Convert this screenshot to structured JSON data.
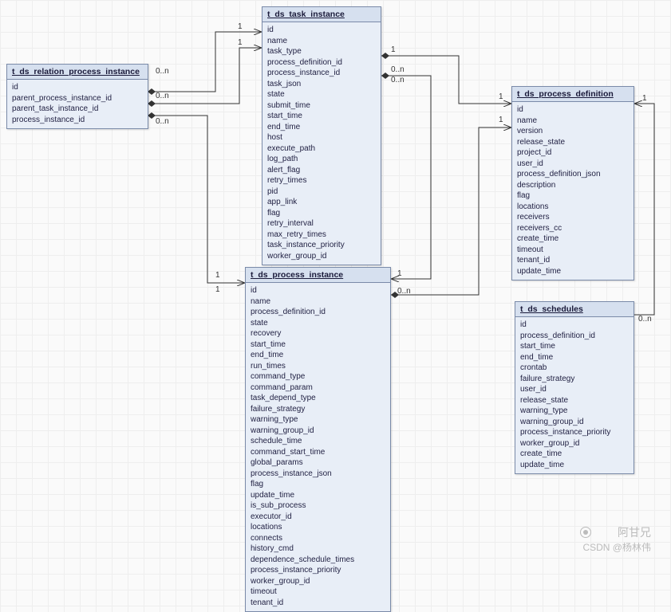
{
  "entities": {
    "relation_process_instance": {
      "title": "t_ds_relation_process_instance",
      "fields": [
        "id",
        "parent_process_instance_id",
        "parent_task_instance_id",
        "process_instance_id"
      ]
    },
    "task_instance": {
      "title": "t_ds_task_instance",
      "fields": [
        "id",
        "name",
        "task_type",
        "process_definition_id",
        "process_instance_id",
        "task_json",
        "state",
        "submit_time",
        "start_time",
        "end_time",
        "host",
        "execute_path",
        "log_path",
        "alert_flag",
        "retry_times",
        "pid",
        "app_link",
        "flag",
        "retry_interval",
        "max_retry_times",
        "task_instance_priority",
        "worker_group_id"
      ]
    },
    "process_definition": {
      "title": "t_ds_process_definition",
      "fields": [
        "id",
        "name",
        "version",
        "release_state",
        "project_id",
        "user_id",
        "process_definition_json",
        "description",
        "flag",
        "locations",
        "receivers",
        "receivers_cc",
        "create_time",
        "timeout",
        "tenant_id",
        "update_time"
      ]
    },
    "process_instance": {
      "title": "t_ds_process_instance",
      "fields": [
        "id",
        "name",
        "process_definition_id",
        "state",
        "recovery",
        "start_time",
        "end_time",
        "run_times",
        "command_type",
        "command_param",
        "task_depend_type",
        "failure_strategy",
        "warning_type",
        "warning_group_id",
        "schedule_time",
        "command_start_time",
        "global_params",
        "process_instance_json",
        "flag",
        "update_time",
        "is_sub_process",
        "executor_id",
        "locations",
        "connects",
        "history_cmd",
        "dependence_schedule_times",
        "process_instance_priority",
        "worker_group_id",
        "timeout",
        "tenant_id"
      ]
    },
    "schedules": {
      "title": "t_ds_schedules",
      "fields": [
        "id",
        "process_definition_id",
        "start_time",
        "end_time",
        "crontab",
        "failure_strategy",
        "user_id",
        "release_state",
        "warning_type",
        "warning_group_id",
        "process_instance_priority",
        "worker_group_id",
        "create_time",
        "update_time"
      ]
    }
  },
  "cardinalities": {
    "c1": "1",
    "c2": "0..n",
    "c3": "1",
    "c4": "0..n",
    "c5": "1",
    "c6": "0..n",
    "c7": "1",
    "c8": "1",
    "c9": "1",
    "c10": "0..n",
    "c11": "1",
    "c12": "0..n",
    "c13": "1",
    "c14": "0..n",
    "c15": "1",
    "c16": "0..n"
  },
  "watermarks": {
    "wm1": "阿甘兄",
    "wm2": "CSDN @杨林伟"
  }
}
